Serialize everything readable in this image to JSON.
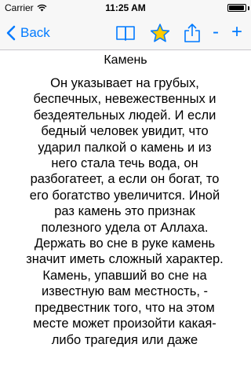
{
  "status_bar": {
    "carrier": "Carrier",
    "time": "11:25 AM",
    "battery_level": 0.95
  },
  "nav": {
    "back_label": "Back",
    "icons": [
      "book-icon",
      "star-icon",
      "share-icon"
    ],
    "minus_label": "-",
    "plus_label": "+",
    "accent_color": "#007aff",
    "star_color": "#ffcc00"
  },
  "article": {
    "title": "Камень",
    "lines": [
      "Он указывает на грубых,",
      "беспечных, невежественных и",
      "бездеятельных людей. И если",
      "бедный человек увидит, что",
      "ударил палкой о камень и из",
      "него стала течь вода, он",
      "разбогатеет, а если он богат, то",
      "его богатство увеличится. Иной",
      "раз камень это признак",
      "полезного удела от Аллаха.",
      "Держать во сне в руке камень",
      "значит иметь сложный характер.",
      "Камень, упавший во сне на",
      "известную вам местность, -",
      "предвестник того, что на этом",
      "месте может произойти какая-",
      "либо трагедия или даже"
    ]
  }
}
